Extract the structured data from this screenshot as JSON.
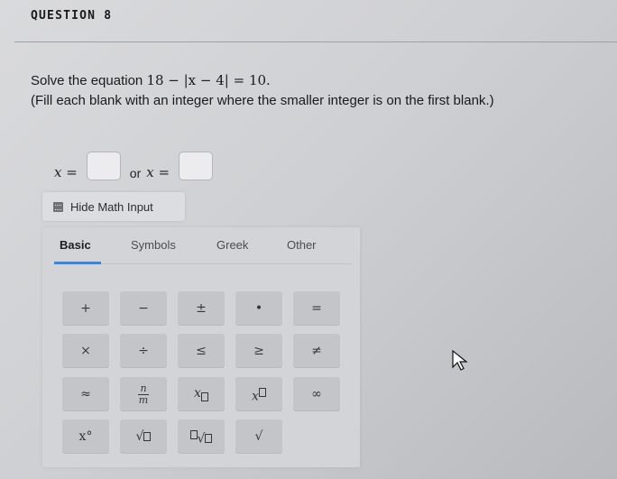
{
  "question": {
    "header": "QUESTION 8",
    "prompt_text": "Solve the equation ",
    "equation": "18 − |x − 4| = 10.",
    "instruction": "(Fill each blank with an integer where the smaller integer is on the first blank.)"
  },
  "answer": {
    "var1": "x =",
    "sep": "or",
    "var2": "x =",
    "blank1_value": "",
    "blank2_value": ""
  },
  "math_input": {
    "toggle_label": "Hide Math Input",
    "tabs": [
      {
        "label": "Basic",
        "active": true
      },
      {
        "label": "Symbols",
        "active": false
      },
      {
        "label": "Greek",
        "active": false
      },
      {
        "label": "Other",
        "active": false
      }
    ],
    "keys": {
      "row1": [
        "+",
        "−",
        "±",
        "•",
        "="
      ],
      "row2": [
        "×",
        "÷",
        "≤",
        "≥",
        "≠"
      ],
      "row3": [
        "≈",
        "n/m",
        "x_□",
        "x^□",
        "∞"
      ],
      "row4": [
        "x°",
        "√□",
        "∛□",
        "√"
      ]
    }
  },
  "colors": {
    "tab_underline": "#4a83c9",
    "key_background": "#c4c5c9",
    "palette_background": "#d3d4d7"
  }
}
